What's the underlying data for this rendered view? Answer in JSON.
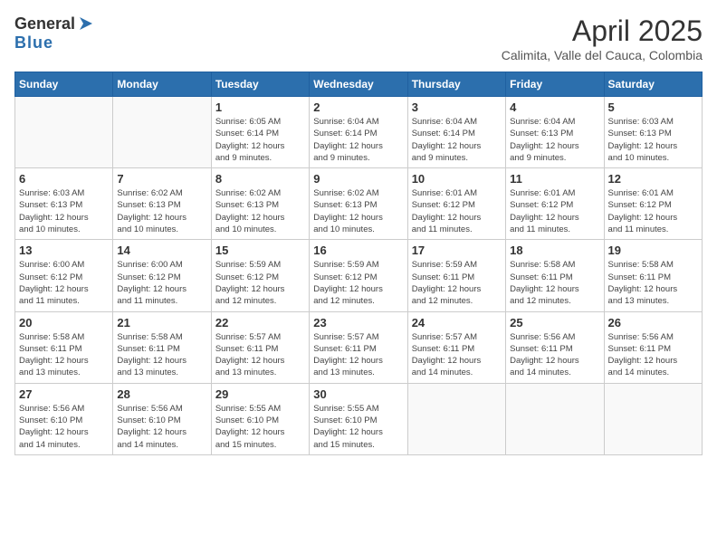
{
  "header": {
    "logo_general": "General",
    "logo_blue": "Blue",
    "month_year": "April 2025",
    "location": "Calimita, Valle del Cauca, Colombia"
  },
  "weekdays": [
    "Sunday",
    "Monday",
    "Tuesday",
    "Wednesday",
    "Thursday",
    "Friday",
    "Saturday"
  ],
  "weeks": [
    [
      {
        "day": "",
        "info": ""
      },
      {
        "day": "",
        "info": ""
      },
      {
        "day": "1",
        "info": "Sunrise: 6:05 AM\nSunset: 6:14 PM\nDaylight: 12 hours\nand 9 minutes."
      },
      {
        "day": "2",
        "info": "Sunrise: 6:04 AM\nSunset: 6:14 PM\nDaylight: 12 hours\nand 9 minutes."
      },
      {
        "day": "3",
        "info": "Sunrise: 6:04 AM\nSunset: 6:14 PM\nDaylight: 12 hours\nand 9 minutes."
      },
      {
        "day": "4",
        "info": "Sunrise: 6:04 AM\nSunset: 6:13 PM\nDaylight: 12 hours\nand 9 minutes."
      },
      {
        "day": "5",
        "info": "Sunrise: 6:03 AM\nSunset: 6:13 PM\nDaylight: 12 hours\nand 10 minutes."
      }
    ],
    [
      {
        "day": "6",
        "info": "Sunrise: 6:03 AM\nSunset: 6:13 PM\nDaylight: 12 hours\nand 10 minutes."
      },
      {
        "day": "7",
        "info": "Sunrise: 6:02 AM\nSunset: 6:13 PM\nDaylight: 12 hours\nand 10 minutes."
      },
      {
        "day": "8",
        "info": "Sunrise: 6:02 AM\nSunset: 6:13 PM\nDaylight: 12 hours\nand 10 minutes."
      },
      {
        "day": "9",
        "info": "Sunrise: 6:02 AM\nSunset: 6:13 PM\nDaylight: 12 hours\nand 10 minutes."
      },
      {
        "day": "10",
        "info": "Sunrise: 6:01 AM\nSunset: 6:12 PM\nDaylight: 12 hours\nand 11 minutes."
      },
      {
        "day": "11",
        "info": "Sunrise: 6:01 AM\nSunset: 6:12 PM\nDaylight: 12 hours\nand 11 minutes."
      },
      {
        "day": "12",
        "info": "Sunrise: 6:01 AM\nSunset: 6:12 PM\nDaylight: 12 hours\nand 11 minutes."
      }
    ],
    [
      {
        "day": "13",
        "info": "Sunrise: 6:00 AM\nSunset: 6:12 PM\nDaylight: 12 hours\nand 11 minutes."
      },
      {
        "day": "14",
        "info": "Sunrise: 6:00 AM\nSunset: 6:12 PM\nDaylight: 12 hours\nand 11 minutes."
      },
      {
        "day": "15",
        "info": "Sunrise: 5:59 AM\nSunset: 6:12 PM\nDaylight: 12 hours\nand 12 minutes."
      },
      {
        "day": "16",
        "info": "Sunrise: 5:59 AM\nSunset: 6:12 PM\nDaylight: 12 hours\nand 12 minutes."
      },
      {
        "day": "17",
        "info": "Sunrise: 5:59 AM\nSunset: 6:11 PM\nDaylight: 12 hours\nand 12 minutes."
      },
      {
        "day": "18",
        "info": "Sunrise: 5:58 AM\nSunset: 6:11 PM\nDaylight: 12 hours\nand 12 minutes."
      },
      {
        "day": "19",
        "info": "Sunrise: 5:58 AM\nSunset: 6:11 PM\nDaylight: 12 hours\nand 13 minutes."
      }
    ],
    [
      {
        "day": "20",
        "info": "Sunrise: 5:58 AM\nSunset: 6:11 PM\nDaylight: 12 hours\nand 13 minutes."
      },
      {
        "day": "21",
        "info": "Sunrise: 5:58 AM\nSunset: 6:11 PM\nDaylight: 12 hours\nand 13 minutes."
      },
      {
        "day": "22",
        "info": "Sunrise: 5:57 AM\nSunset: 6:11 PM\nDaylight: 12 hours\nand 13 minutes."
      },
      {
        "day": "23",
        "info": "Sunrise: 5:57 AM\nSunset: 6:11 PM\nDaylight: 12 hours\nand 13 minutes."
      },
      {
        "day": "24",
        "info": "Sunrise: 5:57 AM\nSunset: 6:11 PM\nDaylight: 12 hours\nand 14 minutes."
      },
      {
        "day": "25",
        "info": "Sunrise: 5:56 AM\nSunset: 6:11 PM\nDaylight: 12 hours\nand 14 minutes."
      },
      {
        "day": "26",
        "info": "Sunrise: 5:56 AM\nSunset: 6:11 PM\nDaylight: 12 hours\nand 14 minutes."
      }
    ],
    [
      {
        "day": "27",
        "info": "Sunrise: 5:56 AM\nSunset: 6:10 PM\nDaylight: 12 hours\nand 14 minutes."
      },
      {
        "day": "28",
        "info": "Sunrise: 5:56 AM\nSunset: 6:10 PM\nDaylight: 12 hours\nand 14 minutes."
      },
      {
        "day": "29",
        "info": "Sunrise: 5:55 AM\nSunset: 6:10 PM\nDaylight: 12 hours\nand 15 minutes."
      },
      {
        "day": "30",
        "info": "Sunrise: 5:55 AM\nSunset: 6:10 PM\nDaylight: 12 hours\nand 15 minutes."
      },
      {
        "day": "",
        "info": ""
      },
      {
        "day": "",
        "info": ""
      },
      {
        "day": "",
        "info": ""
      }
    ]
  ]
}
